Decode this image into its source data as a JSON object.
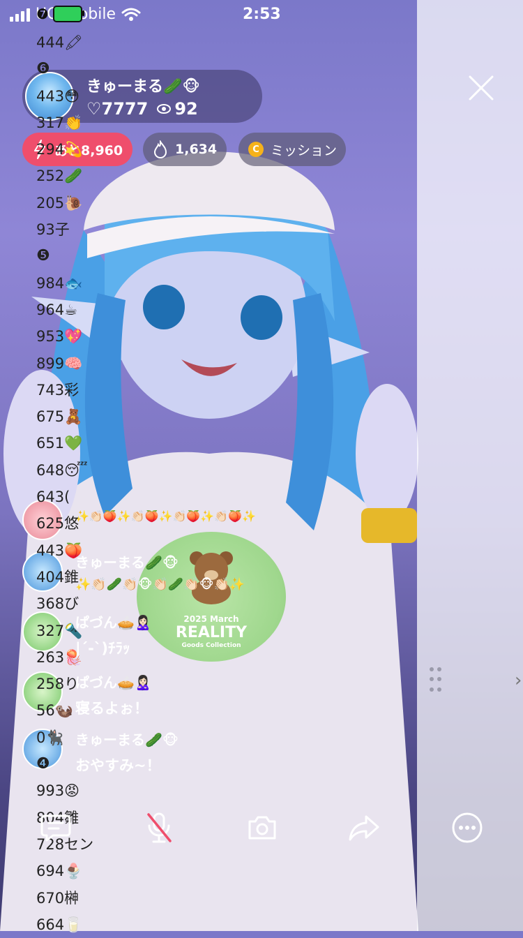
{
  "status_bar": {
    "carrier": "UQ mobile",
    "time": "2:53"
  },
  "host": {
    "name": "きゅーまる🥒🐵",
    "likes": "♡7777",
    "viewers": "92"
  },
  "pills": {
    "goal": "あと8,960",
    "fire": "1,634",
    "mission": "ミッション"
  },
  "ranking": {
    "badge": "❼",
    "items": [
      "444🖍",
      "❻",
      "443😳",
      "317👏",
      "294💫",
      "252🥒",
      "205🐌",
      "93子",
      "❺",
      "984🐟",
      "964☕",
      "953💖",
      "899🧠",
      "743彩",
      "675🧸",
      "651💚",
      "648😴",
      "643(",
      "625悠",
      "443🍑",
      "404錐",
      "368び",
      "327🔦",
      "263🪼",
      "258り",
      "56🦦",
      "0🐈‍⬛",
      "❹",
      "993😡",
      "804雛",
      "728セン",
      "694🍨",
      "670榊",
      "664🥛"
    ]
  },
  "comments": [
    {
      "name": "",
      "text": "✨👏🏻🍑✨👏🏻🍑✨👏🏻🍑✨👏🏻🍑✨"
    },
    {
      "name": "きゅーまる🥒🐵",
      "text": "✨👏🏻🥒👏🏻🐵👏🏻🥒👏🏻🐵👏🏻✨"
    },
    {
      "name": "ぱづん🥧🙎🏻‍♀️",
      "text": "|´-`)ﾁﾗｯ"
    },
    {
      "name": "ぱづん🥧🙎🏻‍♀️",
      "text": "寝るよぉ！"
    },
    {
      "name": "きゅーまる🥒🐵",
      "text": "おやすみ~！"
    }
  ],
  "merch": {
    "line1": "2025 March",
    "line2": "REALITY",
    "line3": "Goods Collection"
  },
  "colors": {
    "goal_pill": "#ef4e6c",
    "coin": "#f6b21a",
    "panel": "#ffffff"
  }
}
